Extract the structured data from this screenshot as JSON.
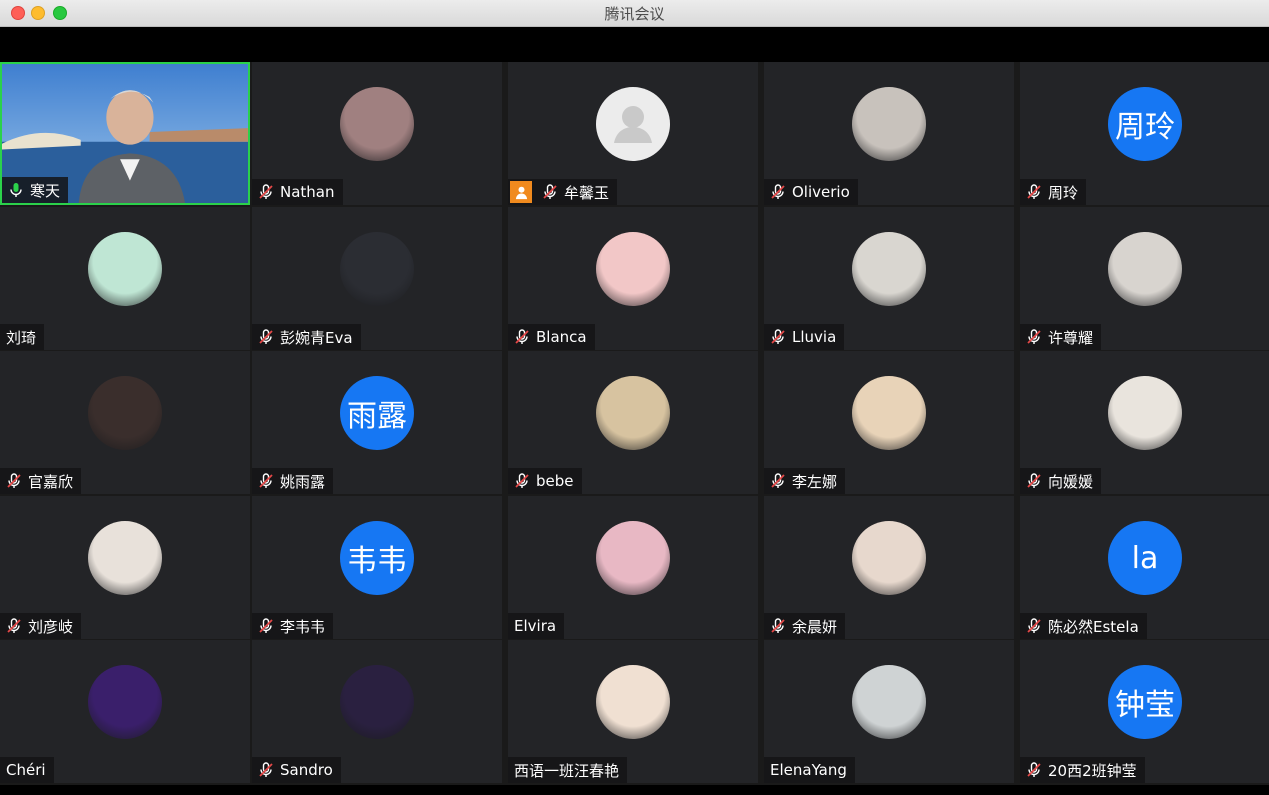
{
  "window": {
    "title": "腾讯会议"
  },
  "participants": [
    {
      "name": "寒天",
      "muted": false,
      "active": true,
      "avatar": "video"
    },
    {
      "name": "Nathan",
      "muted": true,
      "avatar": "photo",
      "color": "#a08080"
    },
    {
      "name": "牟馨玉",
      "muted": true,
      "host": true,
      "avatar": "default"
    },
    {
      "name": "Oliverio",
      "muted": true,
      "avatar": "photo",
      "color": "#c8c2bc"
    },
    {
      "name": "周玲",
      "muted": true,
      "avatar": "text",
      "text": "周玲"
    },
    {
      "name": "刘琦",
      "muted": false,
      "avatar": "photo",
      "color": "#bfe6d4"
    },
    {
      "name": "彭婉青Eva",
      "muted": true,
      "avatar": "photo",
      "color": "#2b2d33"
    },
    {
      "name": "Blanca",
      "muted": true,
      "avatar": "photo",
      "color": "#f2c7c7"
    },
    {
      "name": "Lluvia",
      "muted": true,
      "avatar": "photo",
      "color": "#d9d6d0"
    },
    {
      "name": "许尊耀",
      "muted": true,
      "avatar": "photo",
      "color": "#d8d4cf"
    },
    {
      "name": "官嘉欣",
      "muted": true,
      "avatar": "photo",
      "color": "#3a2e2c"
    },
    {
      "name": "姚雨露",
      "muted": true,
      "avatar": "text",
      "text": "雨露"
    },
    {
      "name": "bebe",
      "muted": true,
      "avatar": "photo",
      "color": "#d7c3a0"
    },
    {
      "name": "李左娜",
      "muted": true,
      "avatar": "photo",
      "color": "#e8d3b8"
    },
    {
      "name": "向媛媛",
      "muted": true,
      "avatar": "photo",
      "color": "#e9e4dd"
    },
    {
      "name": "刘彦岐",
      "muted": true,
      "avatar": "photo",
      "color": "#e8e1da"
    },
    {
      "name": "李韦韦",
      "muted": true,
      "avatar": "text",
      "text": "韦韦"
    },
    {
      "name": "Elvira",
      "muted": false,
      "avatar": "photo",
      "color": "#e8b8c4"
    },
    {
      "name": "余晨妍",
      "muted": true,
      "avatar": "photo",
      "color": "#e7d8cd"
    },
    {
      "name": "陈必然Estela",
      "muted": true,
      "avatar": "text",
      "text": "la"
    },
    {
      "name": "Chéri",
      "muted": false,
      "avatar": "photo",
      "color": "#3a1f6b"
    },
    {
      "name": "Sandro",
      "muted": true,
      "avatar": "photo",
      "color": "#2a2040"
    },
    {
      "name": "西语一班汪春艳",
      "muted": false,
      "avatar": "photo",
      "color": "#f0e0d2"
    },
    {
      "name": "ElenaYang",
      "muted": false,
      "avatar": "photo",
      "color": "#cfd3d4"
    },
    {
      "name": "20西2班钟莹",
      "muted": true,
      "avatar": "text",
      "text": "钟莹"
    }
  ],
  "icons": {
    "mic_active": "mic-icon",
    "mic_muted": "mic-muted-icon",
    "host": "host-badge-icon",
    "default_avatar": "user-silhouette-icon"
  },
  "colors": {
    "accent_blue": "#1677f3",
    "active_border": "#2bd14b",
    "muted_red": "#e54848",
    "host_orange": "#f08a1e"
  }
}
